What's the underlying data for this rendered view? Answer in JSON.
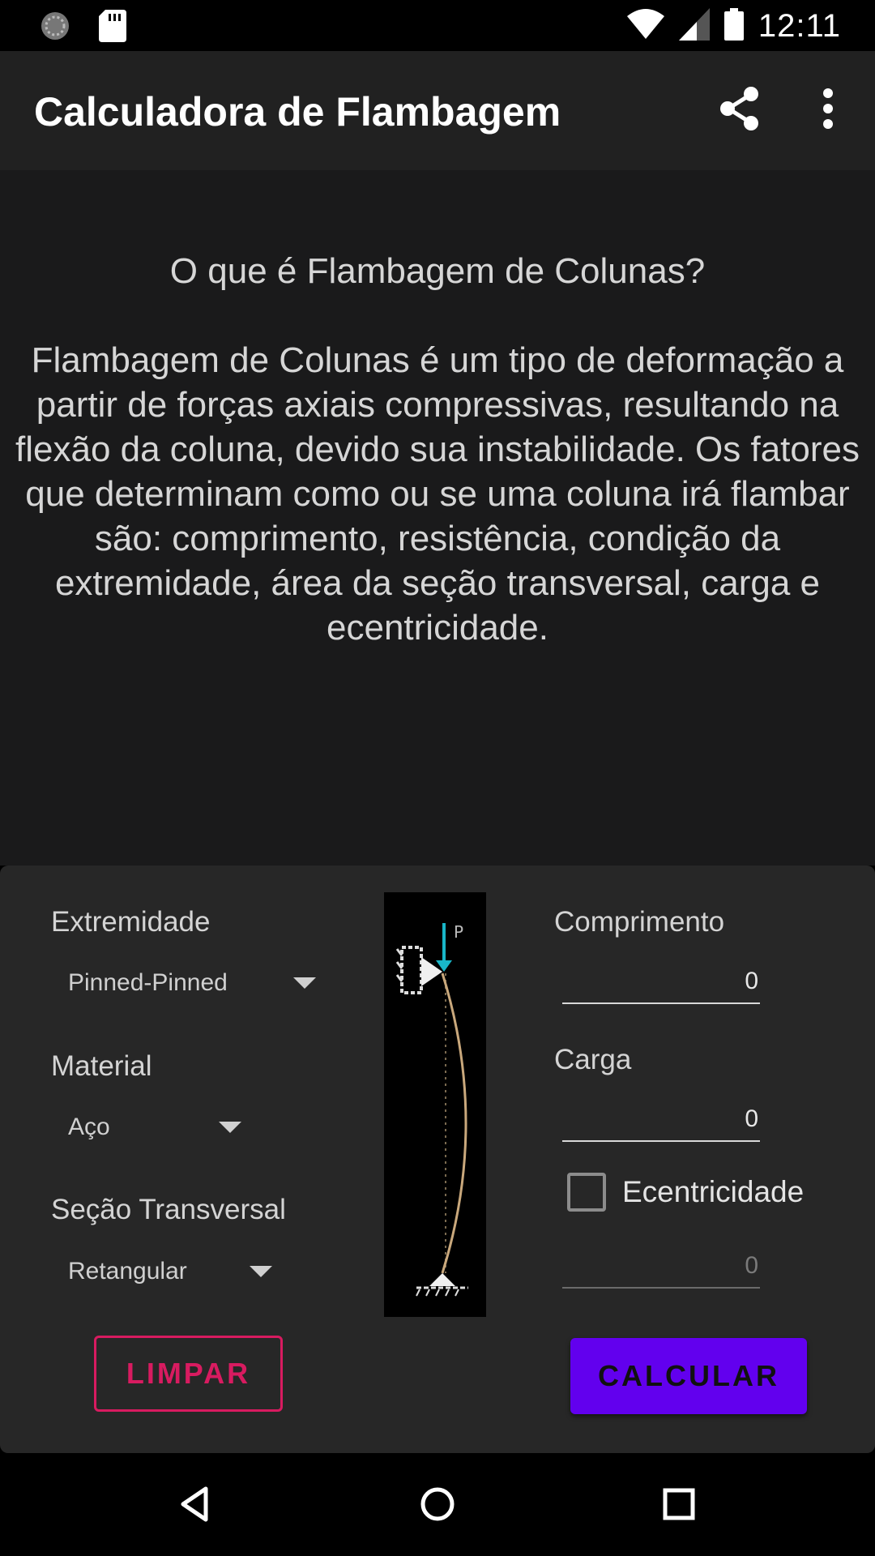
{
  "status_bar": {
    "time": "12:11",
    "icons": [
      "sync-icon",
      "sd-card-icon",
      "wifi-icon",
      "signal-icon",
      "battery-icon"
    ]
  },
  "app_bar": {
    "title": "Calculadora de Flambagem",
    "actions": [
      "share-icon",
      "more-vert-icon"
    ]
  },
  "info": {
    "title": "O que é Flambagem de Colunas?",
    "body": "Flambagem de Colunas é um tipo de deformação a partir de forças axiais compressivas, resultando na flexão da coluna, devido sua instabilidade. Os fatores que determinam como ou se uma coluna irá flambar são: comprimento, resistência, condição da extremidade, área da seção transversal, carga e ecentricidade."
  },
  "form": {
    "extremidade": {
      "label": "Extremidade",
      "value": "Pinned-Pinned"
    },
    "material": {
      "label": "Material",
      "value": "Aço"
    },
    "secao": {
      "label": "Seção Transversal",
      "value": "Retangular"
    },
    "diagram": {
      "load_label": "P"
    },
    "comprimento": {
      "label": "Comprimento",
      "value": "0"
    },
    "carga": {
      "label": "Carga",
      "value": "0"
    },
    "ecentricidade": {
      "label": "Ecentricidade",
      "checked": false,
      "value": "0"
    },
    "limpar_label": "LIMPAR",
    "calcular_label": "CALCULAR"
  },
  "colors": {
    "accent": "#6200ee",
    "secondary": "#d81b60",
    "background": "#1a1a1b",
    "card": "#272727",
    "app_bar": "#212121"
  },
  "nav_bar": {
    "buttons": [
      "back-icon",
      "home-icon",
      "recents-icon"
    ]
  }
}
